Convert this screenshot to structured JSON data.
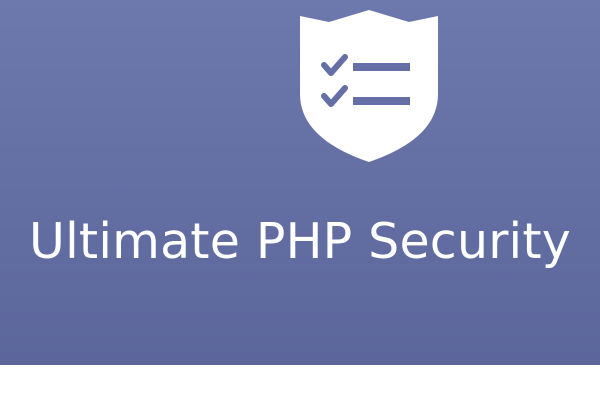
{
  "banner": {
    "title": "Ultimate PHP Security",
    "background_color": "#636ea3",
    "text_color": "#ffffff",
    "icon": "shield-checklist-icon"
  }
}
